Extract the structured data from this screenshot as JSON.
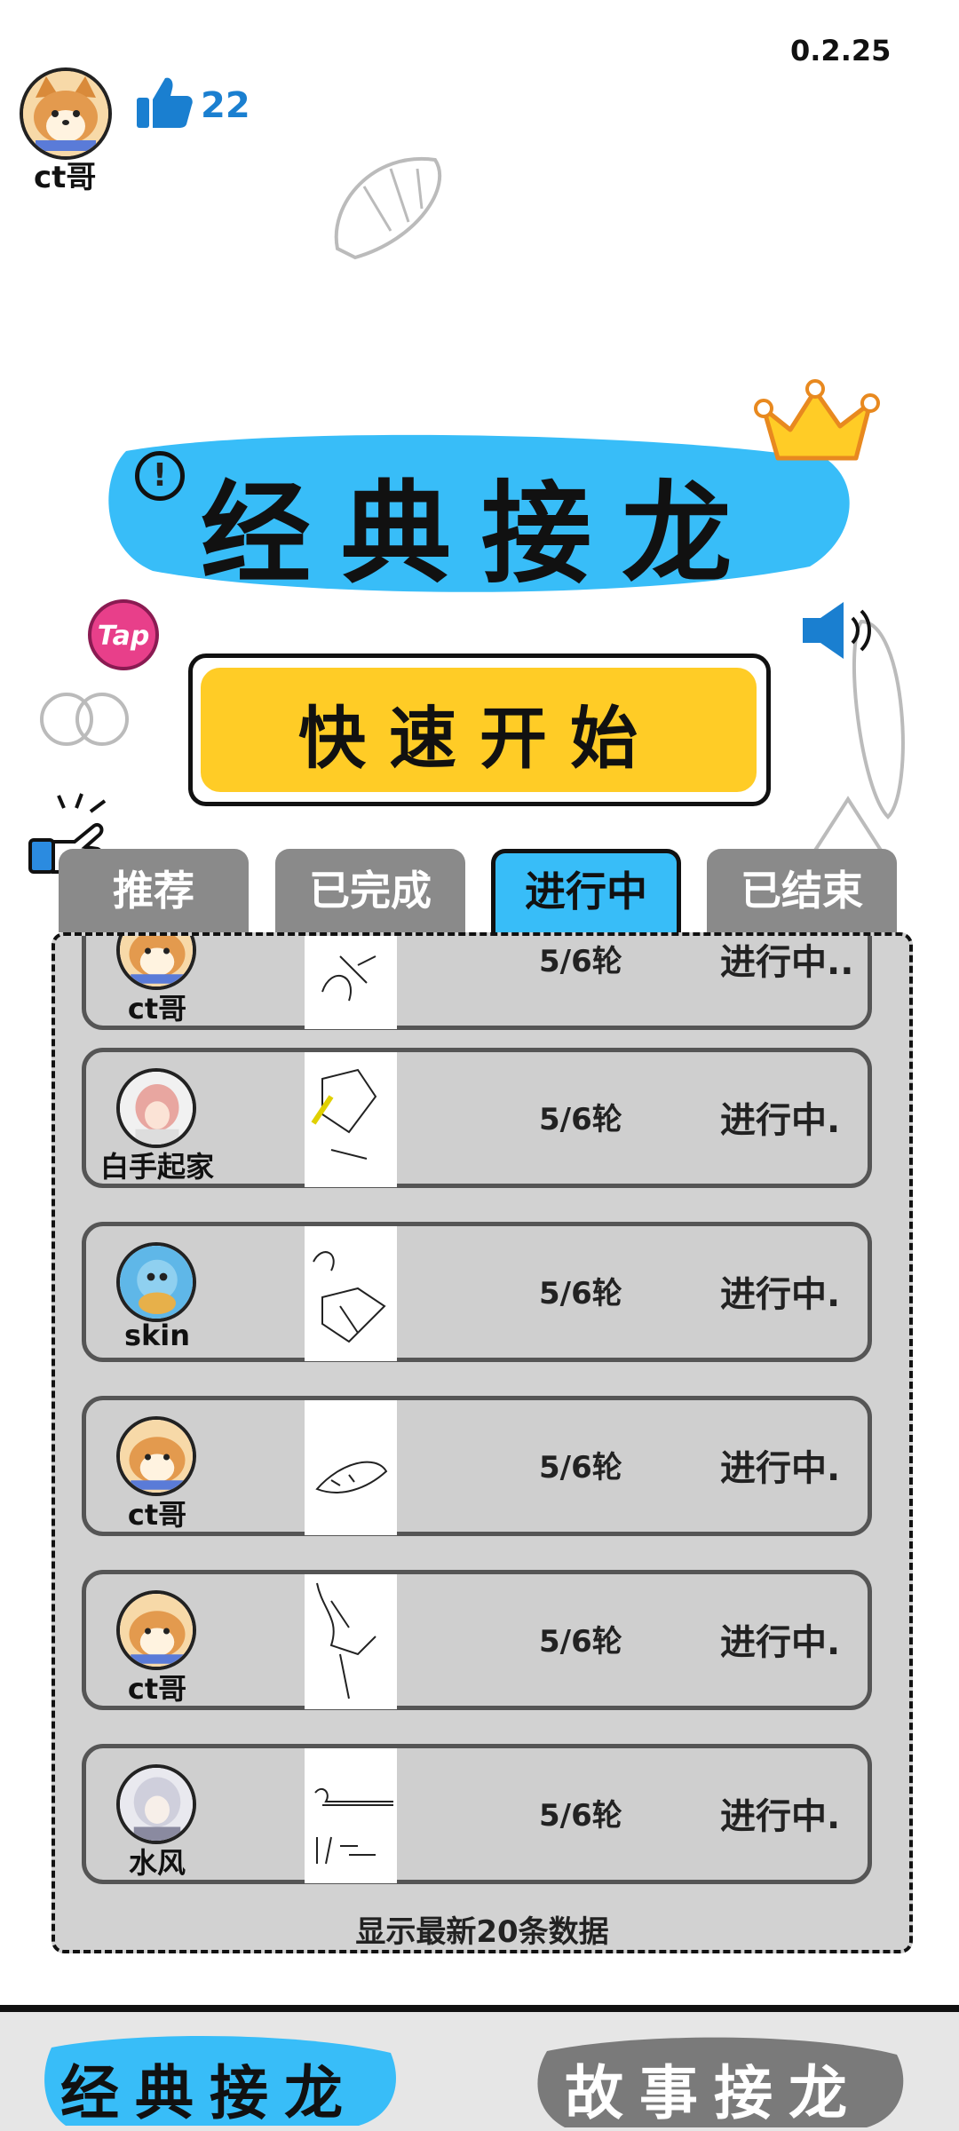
{
  "header": {
    "version": "0.2.25",
    "user_name": "ct哥",
    "likes": "22"
  },
  "title": "经典接龙",
  "quick_start_label": "快速开始",
  "tabs": [
    {
      "label": "推荐",
      "active": false
    },
    {
      "label": "已完成",
      "active": false
    },
    {
      "label": "进行中",
      "active": true
    },
    {
      "label": "已结束",
      "active": false
    }
  ],
  "list": {
    "rows": [
      {
        "name": "ct哥",
        "round": "5/6轮",
        "status": "进行中.."
      },
      {
        "name": "白手起家",
        "round": "5/6轮",
        "status": "进行中."
      },
      {
        "name": "skin",
        "round": "5/6轮",
        "status": "进行中."
      },
      {
        "name": "ct哥",
        "round": "5/6轮",
        "status": "进行中."
      },
      {
        "name": "ct哥",
        "round": "5/6轮",
        "status": "进行中."
      },
      {
        "name": "水风",
        "round": "5/6轮",
        "status": "进行中."
      }
    ],
    "footer": "显示最新20条数据"
  },
  "bottom_nav": {
    "classic": "经典接龙",
    "story": "故事接龙"
  },
  "colors": {
    "accent_blue": "#38bdf8",
    "start_yellow": "#ffcc26",
    "like_blue": "#1a7fd0",
    "tab_gray": "#8a8a8a"
  }
}
